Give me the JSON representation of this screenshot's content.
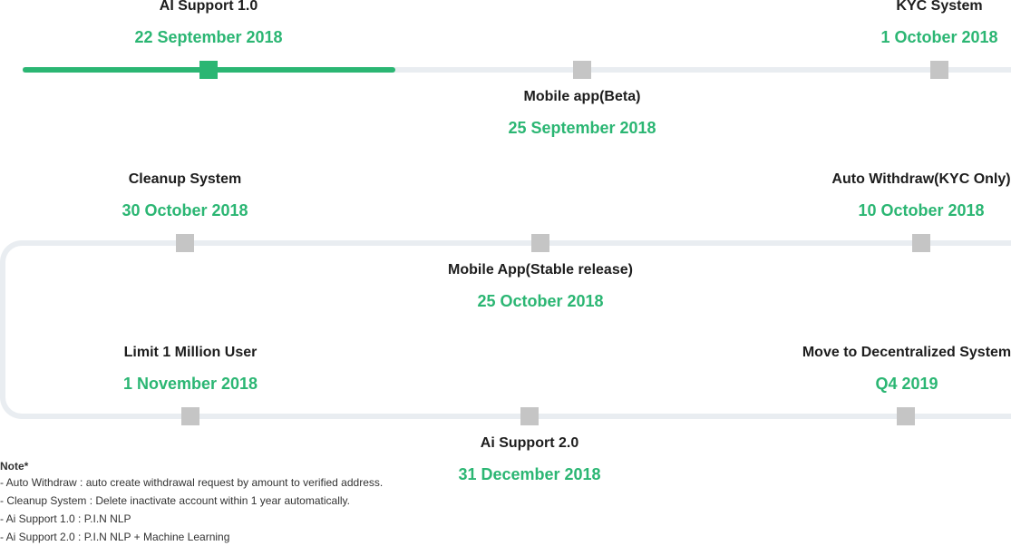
{
  "milestones": [
    {
      "title": "AI Support 1.0",
      "date": "22 September 2018",
      "done": true
    },
    {
      "title": "Mobile app(Beta)",
      "date": "25 September 2018",
      "done": false
    },
    {
      "title": "KYC System",
      "date": "1 October 2018",
      "done": false
    },
    {
      "title": "Auto Withdraw(KYC Only)",
      "date": "10 October 2018",
      "done": false
    },
    {
      "title": "Mobile App(Stable release)",
      "date": "25 October 2018",
      "done": false
    },
    {
      "title": "Cleanup System",
      "date": "30 October 2018",
      "done": false
    },
    {
      "title": "Limit 1 Million User",
      "date": "1 November 2018",
      "done": false
    },
    {
      "title": "Ai Support 2.0",
      "date": "31 December 2018",
      "done": false
    },
    {
      "title": "Move to Decentralized System",
      "date": "Q4 2019",
      "done": false
    }
  ],
  "note": {
    "title": "Note*",
    "lines": [
      "- Auto Withdraw : auto create withdrawal request by amount to verified address.",
      "- Cleanup System : Delete inactivate account within 1 year automatically.",
      "- Ai Support 1.0 : P.I.N NLP",
      "- Ai Support 2.0 : P.I.N NLP + Machine Learning"
    ]
  },
  "colors": {
    "accent": "#2bb673",
    "track": "#e9edf1",
    "node": "#c5c5c5"
  }
}
